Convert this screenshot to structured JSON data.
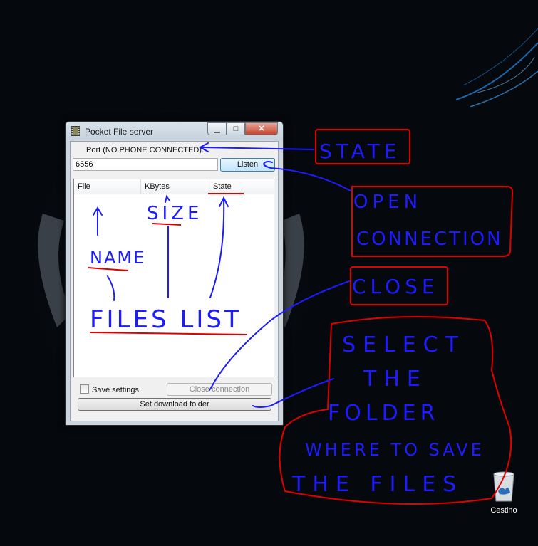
{
  "window": {
    "title": "Pocket File server",
    "port_label": "Port (NO PHONE CONNECTED):",
    "port_value": "6556",
    "listen_label": "Listen",
    "columns": [
      "File",
      "KBytes",
      "State"
    ],
    "save_settings_label": "Save settings",
    "close_connection_label": "Close connection",
    "set_download_folder_label": "Set download folder"
  },
  "desktop": {
    "recycle_bin_label": "Cestino"
  },
  "annotations": {
    "state": "STATE",
    "open_connection_1": "OPEN",
    "open_connection_2": "CONNECTION",
    "close": "CLOSE",
    "select_1": "SELECT",
    "select_2": "THE",
    "select_3": "FOLDER",
    "select_4": "WHERE TO SAVE",
    "select_5": "THE FILES",
    "name": "NAME",
    "size": "SIZE",
    "files_list": "FILES LIST"
  },
  "colors": {
    "annotation_ink": "#1c1cff",
    "annotation_box": "#e00000",
    "desktop_glow": "#1e7fd6"
  }
}
